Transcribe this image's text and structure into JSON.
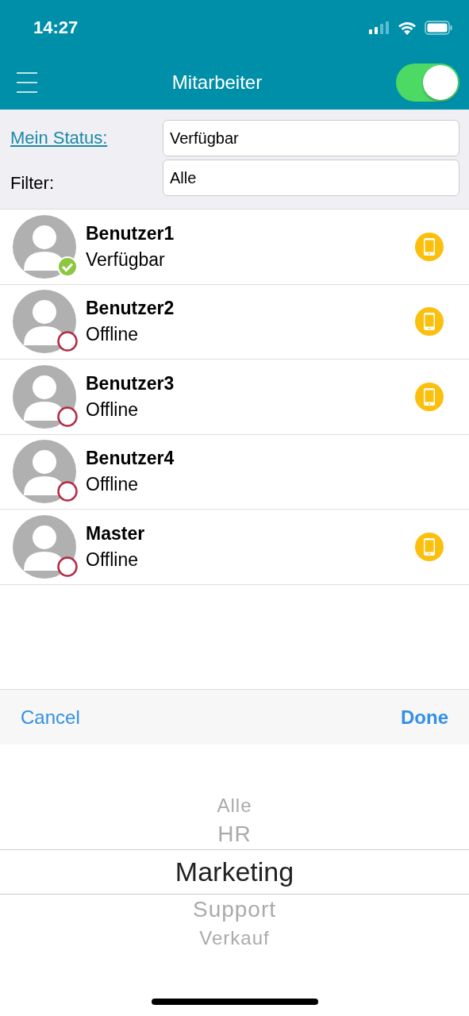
{
  "status_bar": {
    "time": "14:27"
  },
  "nav": {
    "title": "Mitarbeiter",
    "toggle_on": true
  },
  "filters": {
    "status_label": "Mein Status:",
    "status_value": "Verfügbar",
    "filter_label": "Filter:",
    "filter_value": "Alle"
  },
  "users": [
    {
      "name": "Benutzer1",
      "status": "Verfügbar",
      "kind": "available",
      "phone": true
    },
    {
      "name": "Benutzer2",
      "status": "Offline",
      "kind": "offline",
      "phone": true
    },
    {
      "name": "Benutzer3",
      "status": "Offline",
      "kind": "offline",
      "phone": true
    },
    {
      "name": "Benutzer4",
      "status": "Offline",
      "kind": "offline",
      "phone": false
    },
    {
      "name": "Master",
      "status": "Offline",
      "kind": "offline",
      "phone": true
    }
  ],
  "toolbar": {
    "cancel": "Cancel",
    "done": "Done"
  },
  "picker": [
    {
      "label": "Alle",
      "selected": false
    },
    {
      "label": "HR",
      "selected": false
    },
    {
      "label": "Marketing",
      "selected": true
    },
    {
      "label": "Support",
      "selected": false
    },
    {
      "label": "Verkauf",
      "selected": false
    }
  ]
}
